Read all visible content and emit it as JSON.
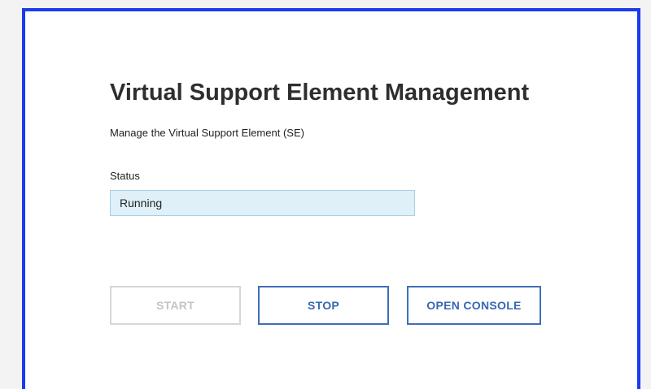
{
  "panel": {
    "title": "Virtual Support Element Management",
    "subtitle": "Manage the Virtual Support Element (SE)",
    "status_label": "Status",
    "status_value": "Running"
  },
  "buttons": {
    "start_label": "START",
    "start_enabled": false,
    "stop_label": "STOP",
    "open_console_label": "OPEN CONSOLE"
  },
  "colors": {
    "panel_border": "#1a3bf0",
    "status_field_bg": "#dff0f8",
    "button_accent": "#3668b4",
    "disabled_text": "#c4c4c4"
  }
}
